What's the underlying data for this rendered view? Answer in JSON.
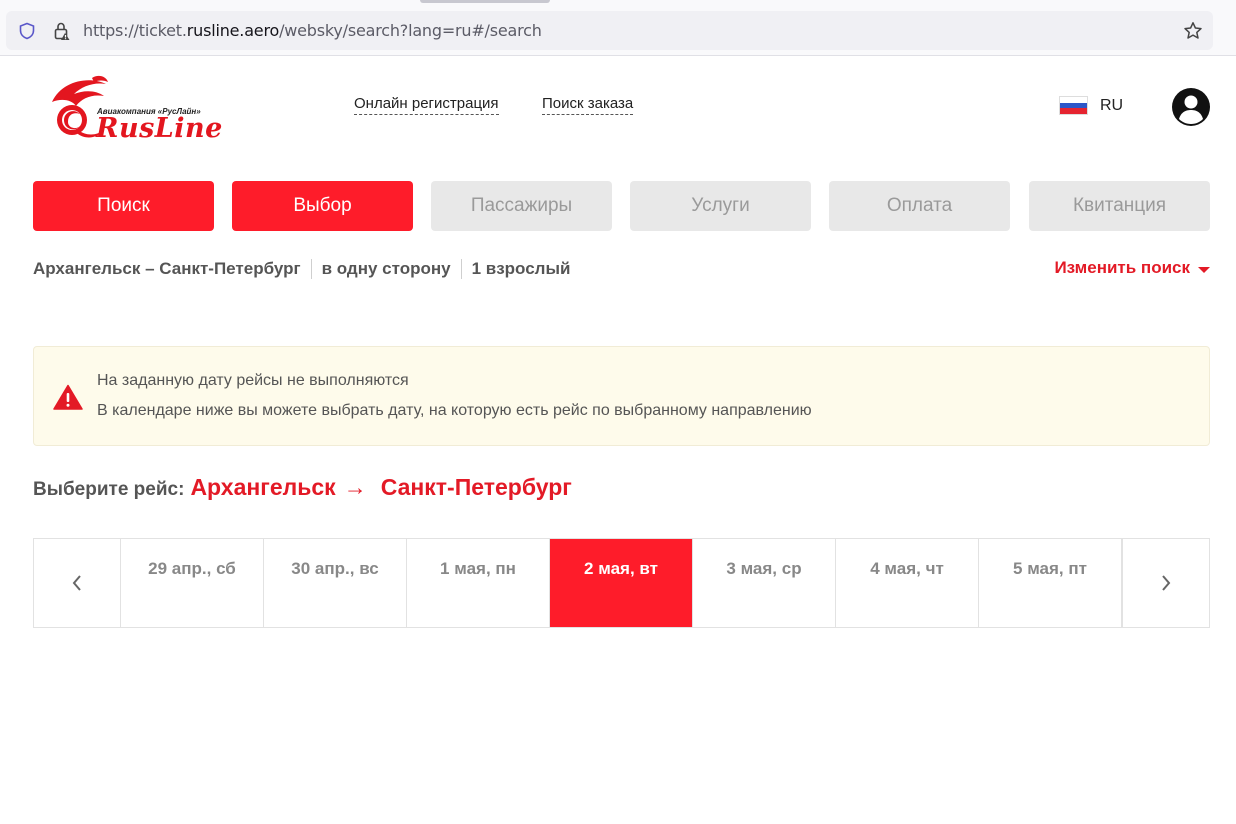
{
  "browser": {
    "url_prefix": "https://ticket.",
    "url_host": "rusline.aero",
    "url_path": "/websky/search?lang=ru#/search"
  },
  "header": {
    "logo_tagline": "Авиакомпания «РусЛайн»",
    "logo_word": "RusLine",
    "nav": {
      "online_registration": "Онлайн регистрация",
      "find_order": "Поиск заказа"
    },
    "language": "RU"
  },
  "steps": [
    {
      "label": "Поиск",
      "state": "active"
    },
    {
      "label": "Выбор",
      "state": "active"
    },
    {
      "label": "Пассажиры",
      "state": "inactive"
    },
    {
      "label": "Услуги",
      "state": "inactive"
    },
    {
      "label": "Оплата",
      "state": "inactive"
    },
    {
      "label": "Квитанция",
      "state": "inactive"
    }
  ],
  "summary": {
    "route": "Архангельск – Санкт-Петербург",
    "trip_type": "в одну сторону",
    "passengers": "1 взрослый",
    "change_search": "Изменить поиск"
  },
  "alert": {
    "line1": "На заданную дату рейсы не выполняются",
    "line2": "В календаре ниже вы можете выбрать дату, на которую есть рейс по выбранному направлению"
  },
  "select_flight": {
    "label": "Выберите рейс:",
    "from": "Архангельск",
    "arrow": "→",
    "to": "Санкт-Петербург"
  },
  "dates": [
    {
      "label": "29 апр., сб",
      "selected": false
    },
    {
      "label": "30 апр., вс",
      "selected": false
    },
    {
      "label": "1 мая, пн",
      "selected": false
    },
    {
      "label": "2 мая, вт",
      "selected": true
    },
    {
      "label": "3 мая, ср",
      "selected": false
    },
    {
      "label": "4 мая, чт",
      "selected": false
    },
    {
      "label": "5 мая, пт",
      "selected": false
    }
  ],
  "colors": {
    "brand_red": "#fe1c2a",
    "link_red": "#e31a26",
    "inactive_step": "#e8e8e8",
    "alert_bg": "#fefbeb"
  }
}
